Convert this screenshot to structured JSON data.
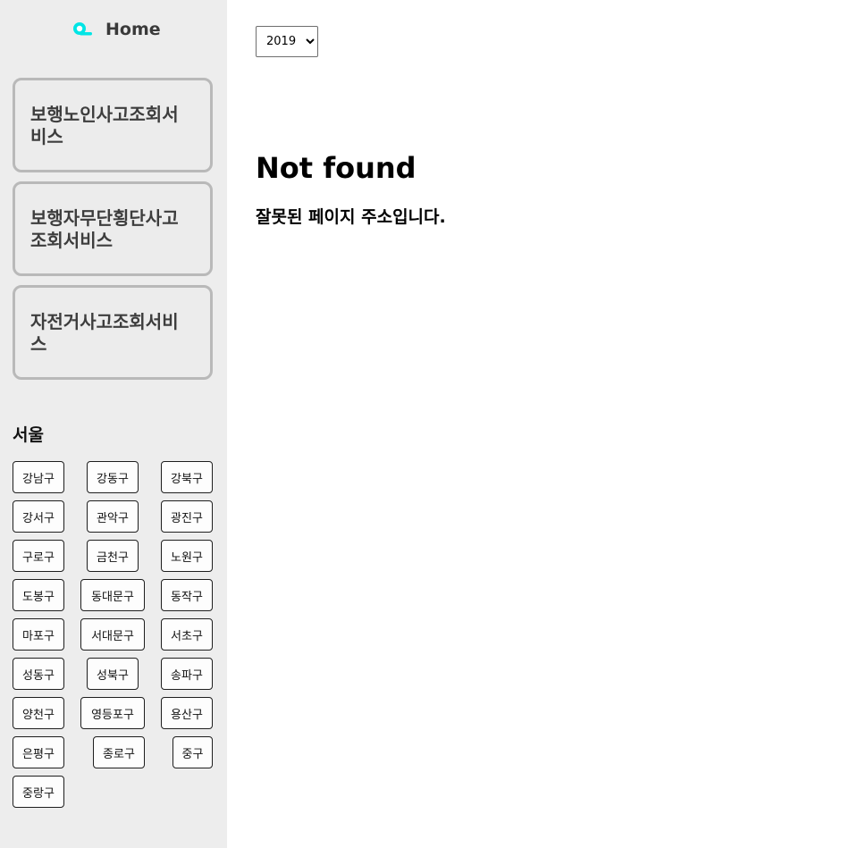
{
  "sidebar": {
    "home": {
      "label": "Home",
      "icon": "search-logo-icon",
      "icon_color": "#00e5e5"
    },
    "services": [
      {
        "label": "보행노인사고조회서비스"
      },
      {
        "label": "보행자무단횡단사고조회서비스"
      },
      {
        "label": "자전거사고조회서비스"
      }
    ],
    "region": {
      "title": "서울",
      "districts": [
        "강남구",
        "강동구",
        "강북구",
        "강서구",
        "관악구",
        "광진구",
        "구로구",
        "금천구",
        "노원구",
        "도봉구",
        "동대문구",
        "동작구",
        "마포구",
        "서대문구",
        "서초구",
        "성동구",
        "성북구",
        "송파구",
        "양천구",
        "영등포구",
        "용산구",
        "은평구",
        "종로구",
        "중구",
        "중랑구"
      ]
    }
  },
  "main": {
    "year_select": {
      "value": "2019"
    },
    "not_found": {
      "title": "Not found",
      "description": "잘못된 페이지 주소입니다."
    }
  },
  "colors": {
    "sidebar_bg": "#ededed",
    "card_border": "#b9b9b9",
    "accent": "#00e5e5"
  }
}
